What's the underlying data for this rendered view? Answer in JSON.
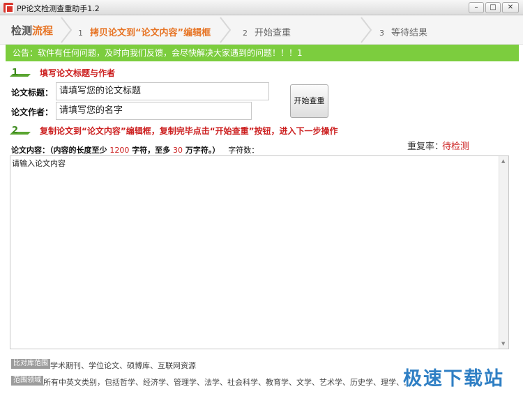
{
  "window": {
    "title": "PP论文检测查重助手1.2",
    "controls": {
      "minimize": "–",
      "maximize": "□",
      "close": "✕"
    }
  },
  "steps": {
    "heading_part1": "检测",
    "heading_part2": "流程",
    "items": [
      {
        "num": "1",
        "label": "拷贝论文到“论文内容”编辑框"
      },
      {
        "num": "2",
        "label": "开始查重"
      },
      {
        "num": "3",
        "label": "等待结果"
      }
    ]
  },
  "notice": "公告：软件有任何问题，及时向我们反馈，会尽快解决大家遇到的问题！！！1",
  "section1": {
    "badge": "1",
    "title": "填写论文标题与作者"
  },
  "form": {
    "title_label": "论文标题：",
    "title_value": "请填写您的论文标题",
    "author_label": "论文作者：",
    "author_value": "请填写您的名字",
    "start_button": "开始查重"
  },
  "section2": {
    "badge": "2",
    "title": "复制论文到“论文内容”编辑框，复制完毕点击“开始查重”按钮，进入下一步操作"
  },
  "result": {
    "label": "重复率：",
    "value": "待检测"
  },
  "content": {
    "hint_prefix": "论文内容：（",
    "hint_mid1": "内容的长度至少",
    "min_chars": "1200",
    "hint_mid2": "字符，至多",
    "max_chars": "30",
    "hint_mid3": "万字符。）",
    "count_label": "字符数：",
    "placeholder": "请输入论文内容"
  },
  "footer": {
    "compare_tag": "比对库范围",
    "compare_text": "学术期刊、学位论文、硕博库、互联网资源",
    "scope_tag": "范围领域",
    "scope_text": "所有中英文类别，包括哲学、经济学、管理学、法学、社会科学、教育学、文学、艺术学、历史学、理学、工学、农学、医学、军事学"
  },
  "watermark": "极速下载站",
  "colors": {
    "accent": "#e77424",
    "notice_bg": "#7ccd3e",
    "red": "#cc1f1f",
    "badge_green": "#5aa531"
  }
}
